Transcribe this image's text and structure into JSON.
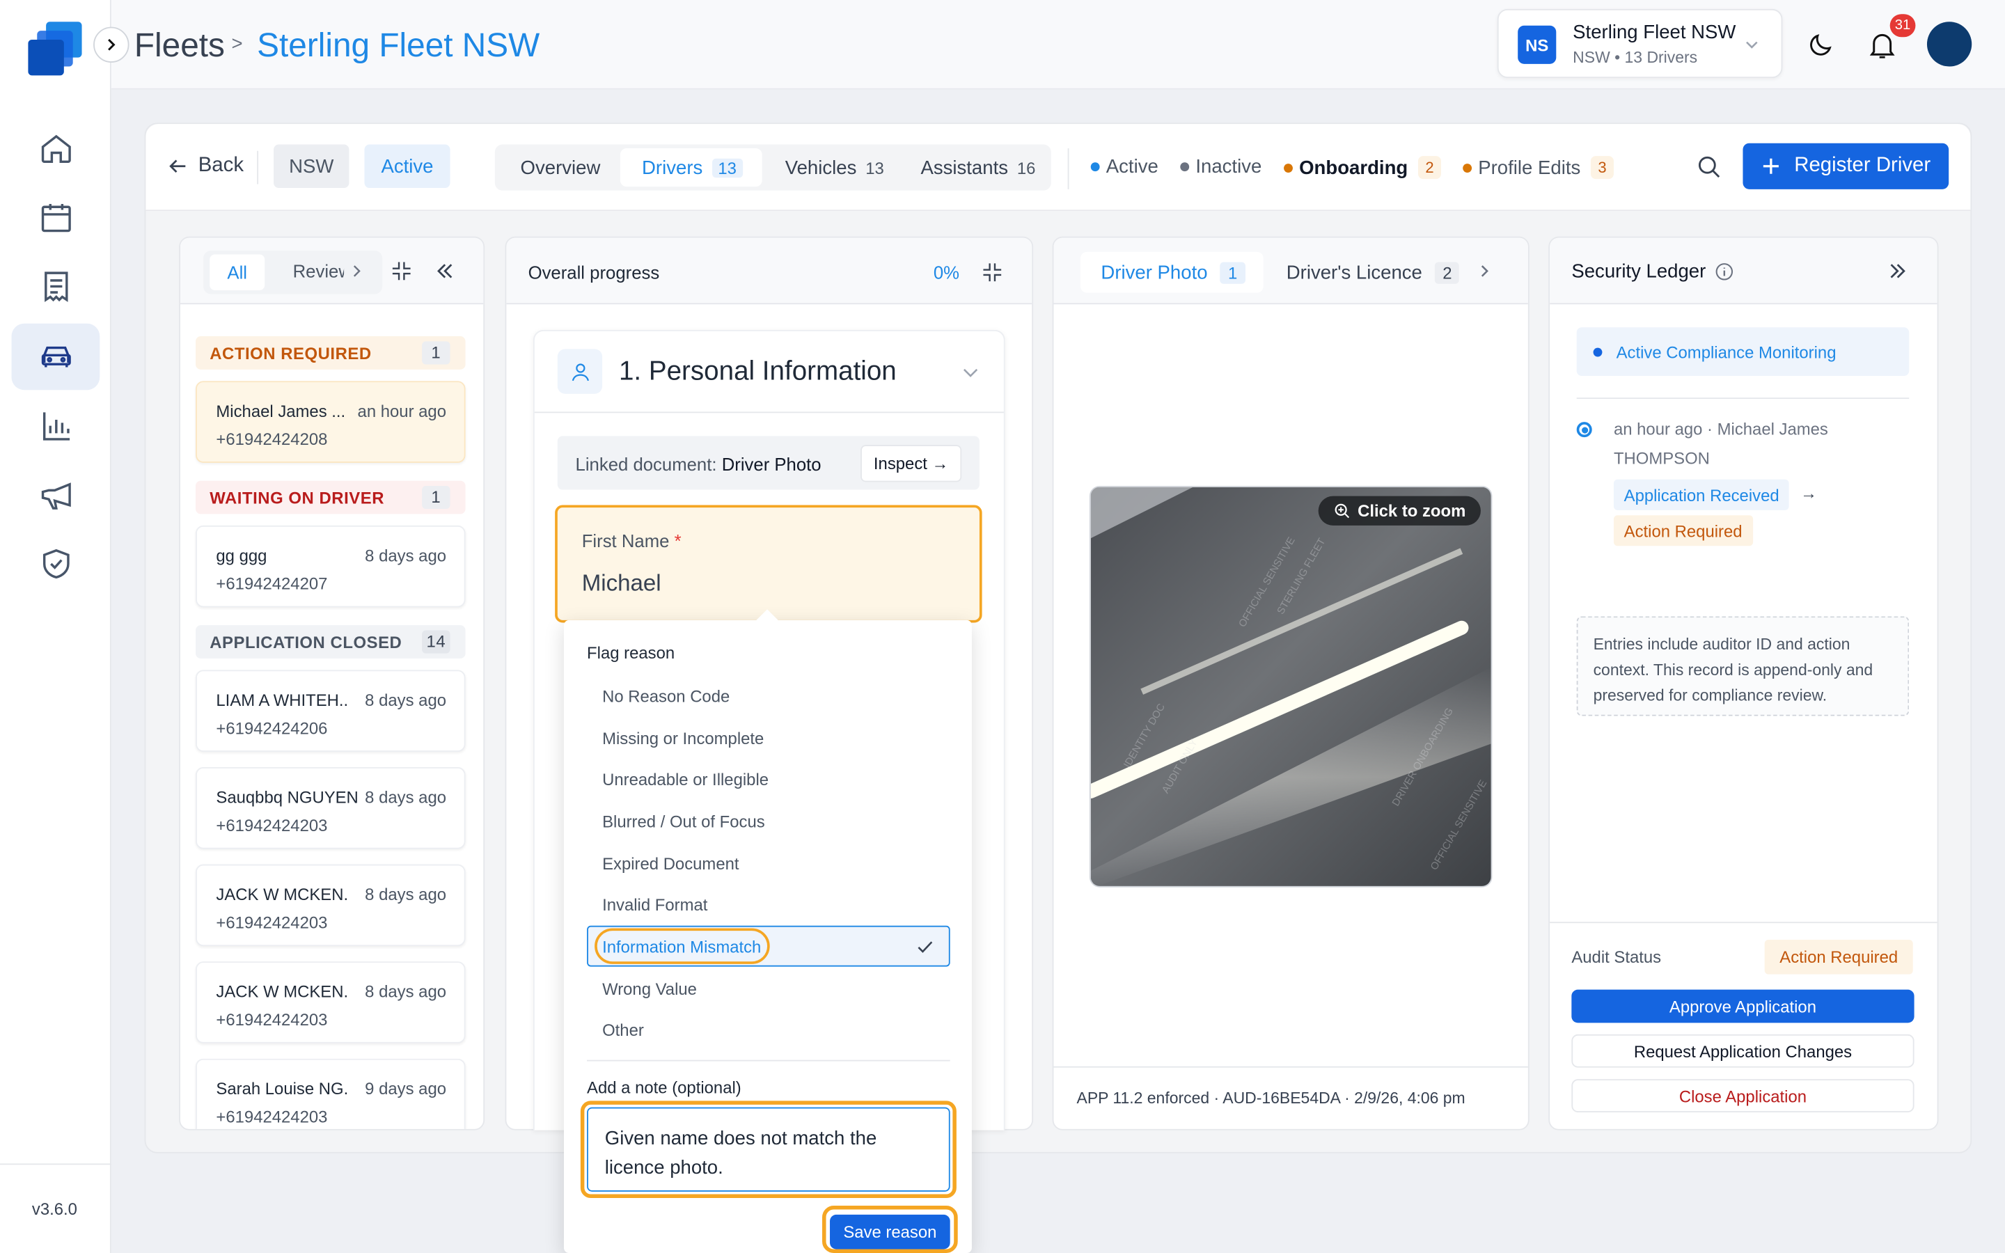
{
  "app": {
    "version": "v3.6.0"
  },
  "breadcrumb": {
    "root": "Fleets",
    "separator": ">",
    "current": "Sterling Fleet NSW"
  },
  "org": {
    "badge": "NS",
    "name": "Sterling Fleet NSW",
    "meta": "NSW • 13 Drivers"
  },
  "notifications": {
    "count": "31"
  },
  "toolbar": {
    "back": "Back",
    "region": "NSW",
    "state": "Active",
    "tabs": [
      {
        "label": "Overview",
        "count": ""
      },
      {
        "label": "Drivers",
        "count": "13"
      },
      {
        "label": "Vehicles",
        "count": "13"
      },
      {
        "label": "Assistants",
        "count": "16"
      }
    ],
    "statuses": [
      {
        "label": "Active",
        "count": "",
        "color": "#1e88e5"
      },
      {
        "label": "Inactive",
        "count": "",
        "color": "#6b7280"
      },
      {
        "label": "Onboarding",
        "count": "2",
        "color": "#d97706"
      },
      {
        "label": "Profile Edits",
        "count": "3",
        "color": "#d97706"
      }
    ],
    "register": "Register Driver"
  },
  "queue": {
    "filter_all": "All",
    "filter_review": "Review",
    "sections": [
      {
        "label": "ACTION REQUIRED",
        "count": "1"
      },
      {
        "label": "WAITING ON DRIVER",
        "count": "1"
      },
      {
        "label": "APPLICATION CLOSED",
        "count": "14"
      }
    ],
    "drivers": [
      {
        "name": "Michael James ...",
        "time": "an hour ago",
        "phone": "+61942424208"
      },
      {
        "name": "gg ggg",
        "time": "8 days ago",
        "phone": "+61942424207"
      },
      {
        "name": "LIAM A WHITEH...",
        "time": "8 days ago",
        "phone": "+61942424206"
      },
      {
        "name": "Sauqbbq NGUYEN",
        "time": "8 days ago",
        "phone": "+61942424203"
      },
      {
        "name": "JACK W MCKEN...",
        "time": "8 days ago",
        "phone": "+61942424203"
      },
      {
        "name": "JACK W MCKEN...",
        "time": "8 days ago",
        "phone": "+61942424203"
      },
      {
        "name": "Sarah Louise NG...",
        "time": "9 days ago",
        "phone": "+61942424203"
      }
    ]
  },
  "progress": {
    "title": "Overall progress",
    "percent_label": "0%",
    "section_title": "1. Personal Information",
    "linked_prefix": "Linked document:",
    "linked_doc": "Driver Photo",
    "inspect": "Inspect →",
    "field_label": "First Name",
    "required_mark": "*",
    "field_value": "Michael"
  },
  "flag": {
    "title": "Flag reason",
    "options": [
      "No Reason Code",
      "Missing or Incomplete",
      "Unreadable or Illegible",
      "Blurred / Out of Focus",
      "Expired Document",
      "Invalid Format",
      "Information Mismatch",
      "Wrong Value",
      "Other"
    ],
    "selected": "Information Mismatch",
    "note_label": "Add a note (optional)",
    "note_value": "Given name does not match the licence photo.",
    "save": "Save reason"
  },
  "documents": {
    "tabs": [
      {
        "label": "Driver Photo",
        "count": "1"
      },
      {
        "label": "Driver's Licence",
        "count": "2"
      }
    ],
    "zoom": "Click to zoom",
    "footer": "APP 11.2 enforced · AUD-16BE54DA · 2/9/26, 4:06 pm"
  },
  "ledger": {
    "title": "Security Ledger",
    "monitoring": "Active Compliance Monitoring",
    "entry_meta": "an hour ago · Michael James",
    "entry_name": "THOMPSON",
    "from_status": "Application Received",
    "arrow": "→",
    "to_status": "Action Required",
    "note": "Entries include auditor ID and action context. This record is append-only and preserved for compliance review.",
    "audit_label": "Audit Status",
    "audit_value": "Action Required",
    "approve": "Approve Application",
    "request": "Request Application Changes",
    "close": "Close Application"
  },
  "colors": {
    "primary": "#1565e0",
    "link": "#1e88e5",
    "warning": "#d97706",
    "danger": "#b91c1c",
    "highlight": "#f5a623"
  }
}
